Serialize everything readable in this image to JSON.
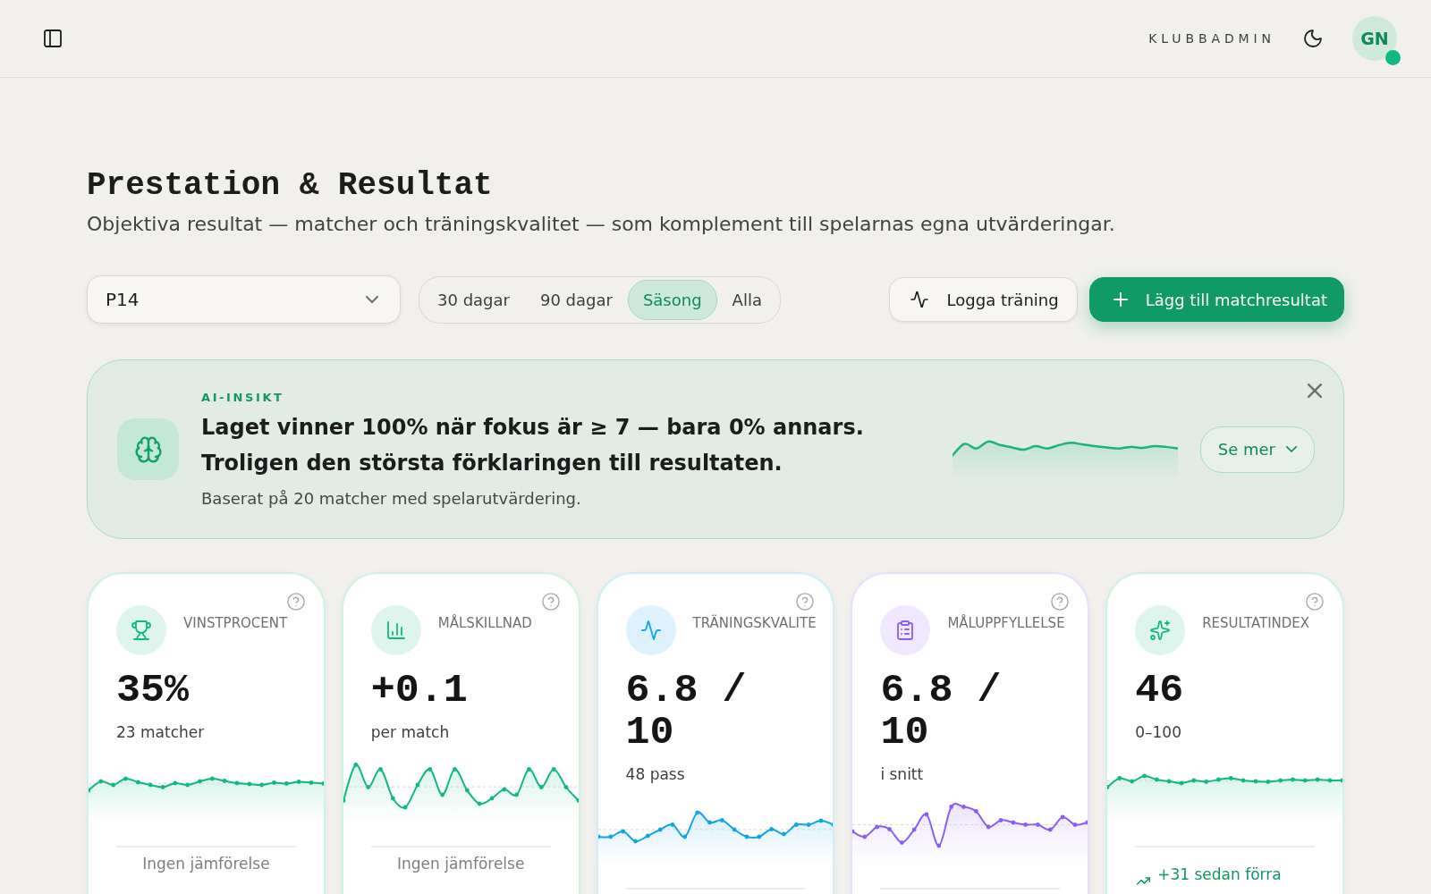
{
  "top_bar": {
    "app_name": "KLUBBADMIN",
    "avatar": {
      "initials": "GN",
      "online": true
    }
  },
  "page": {
    "title": "Prestation & Resultat",
    "subtitle": "Objektiva resultat — matcher och träningskvalitet — som komplement till spelarnas egna utvärderingar."
  },
  "filters": {
    "team_select": {
      "value": "P14"
    },
    "periods": [
      {
        "label": "30 dagar",
        "selected": false
      },
      {
        "label": "90 dagar",
        "selected": false
      },
      {
        "label": "Säsong",
        "selected": true
      },
      {
        "label": "Alla",
        "selected": false
      }
    ],
    "actions": [
      {
        "label": "Logga träning",
        "kind": "secondary"
      },
      {
        "label": "Lägg till matchresultat",
        "kind": "primary"
      }
    ]
  },
  "insight": {
    "label": "AI-INSIKT",
    "headline": "Laget vinner 100% när fokus är ≥ 7 — bara 0% annars. Troligen den största förklaringen till resultaten.",
    "detail": "Baserat på 20 matcher med spelarutvärdering.",
    "action": "Se mer"
  },
  "metric_cards": [
    {
      "label": "VINSTPROCENT",
      "value": "35%",
      "caption": "23 matcher",
      "color": "#10b981",
      "comparison": {
        "text": "Ingen jämförelse",
        "kind": "neutral"
      }
    },
    {
      "label": "MÅLSKILLNAD",
      "value": "+0.1",
      "caption": "per match",
      "color": "#10b981",
      "comparison": {
        "text": "Ingen jämförelse",
        "kind": "neutral"
      }
    },
    {
      "label": "TRÄNINGSKVALITE",
      "value": "6.8 / 10",
      "caption": "48 pass",
      "color": "#0ea5e9"
    },
    {
      "label": "MÅLUPPFYLLELSE",
      "value": "6.8 / 10",
      "caption": "i snitt",
      "color": "#8b5cf6"
    },
    {
      "label": "RESULTATINDEX",
      "value": "46",
      "caption": "0–100",
      "color": "#10b981",
      "comparison": {
        "text": "+31 sedan förra",
        "kind": "rising"
      }
    }
  ]
}
